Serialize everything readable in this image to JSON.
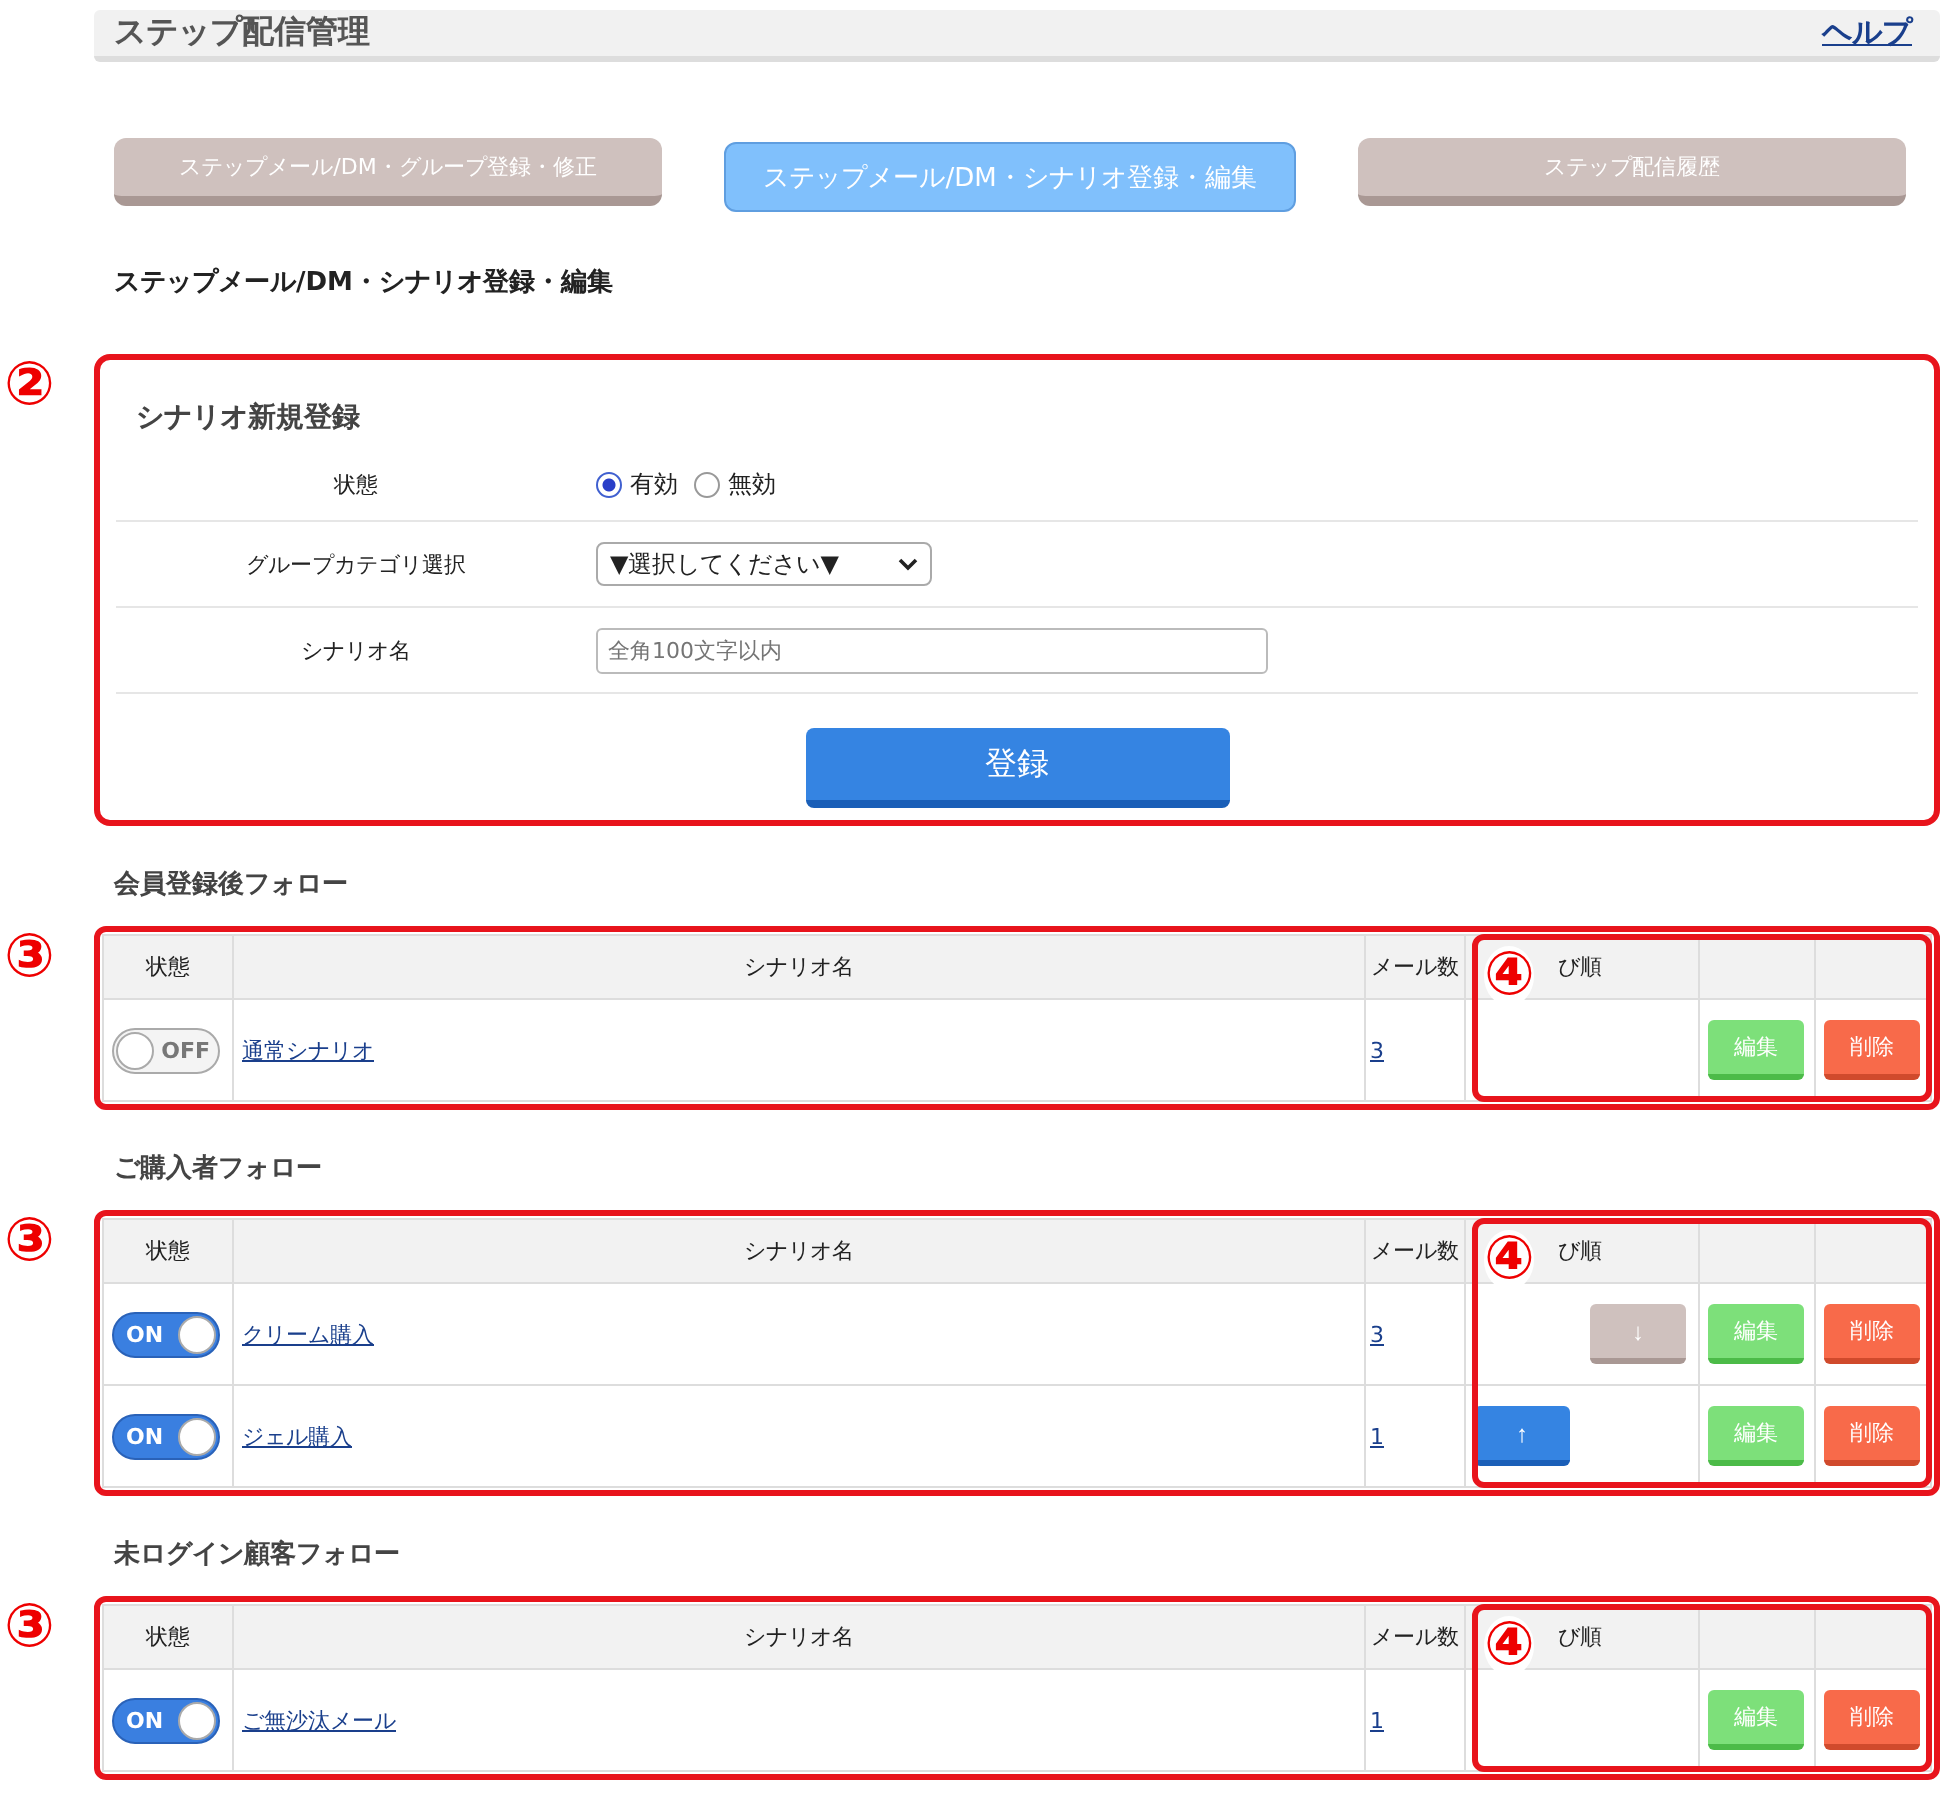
{
  "header": {
    "title": "ステップ配信管理",
    "help_link": "ヘルプ"
  },
  "tabs": [
    {
      "label": "ステップメール/DM・グループ登録・修正",
      "selected": false
    },
    {
      "label": "ステップメール/DM・シナリオ登録・編集",
      "selected": true
    },
    {
      "label": "ステップ配信履歴",
      "selected": false
    }
  ],
  "page_title": "ステップメール/DM・シナリオ登録・編集",
  "form": {
    "marker": "②",
    "title": "シナリオ新規登録",
    "status": {
      "label": "状態",
      "options": [
        {
          "label": "有効",
          "selected": true
        },
        {
          "label": "無効",
          "selected": false
        }
      ]
    },
    "category": {
      "label": "グループカテゴリ選択",
      "value": "▼選択してください▼"
    },
    "name": {
      "label": "シナリオ名",
      "placeholder": "全角100文字以内"
    },
    "submit": "登録"
  },
  "groups": [
    {
      "title": "会員登録後フォロー",
      "marker": "③",
      "sort_marker": "④",
      "columns": [
        "状態",
        "シナリオ名",
        "メール数",
        "び順"
      ],
      "rows": [
        {
          "toggle": {
            "label": "OFF",
            "on": false
          },
          "name": "通常シナリオ",
          "count": "3",
          "sort_buttons": [],
          "edit": "編集",
          "delete": "削除"
        }
      ]
    },
    {
      "title": "ご購入者フォロー",
      "marker": "③",
      "sort_marker": "④",
      "columns": [
        "状態",
        "シナリオ名",
        "メール数",
        "び順"
      ],
      "rows": [
        {
          "toggle": {
            "label": "ON",
            "on": true
          },
          "name": "クリーム購入",
          "count": "3",
          "sort_buttons": [
            {
              "kind": "down",
              "label": "↓"
            }
          ],
          "edit": "編集",
          "delete": "削除"
        },
        {
          "toggle": {
            "label": "ON",
            "on": true
          },
          "name": "ジェル購入",
          "count": "1",
          "sort_buttons": [
            {
              "kind": "up",
              "label": "↑"
            }
          ],
          "edit": "編集",
          "delete": "削除"
        }
      ]
    },
    {
      "title": "未ログイン顧客フォロー",
      "marker": "③",
      "sort_marker": "④",
      "columns": [
        "状態",
        "シナリオ名",
        "メール数",
        "び順"
      ],
      "rows": [
        {
          "toggle": {
            "label": "ON",
            "on": true
          },
          "name": "ご無沙汰メール",
          "count": "1",
          "sort_buttons": [],
          "edit": "編集",
          "delete": "削除"
        }
      ]
    }
  ]
}
